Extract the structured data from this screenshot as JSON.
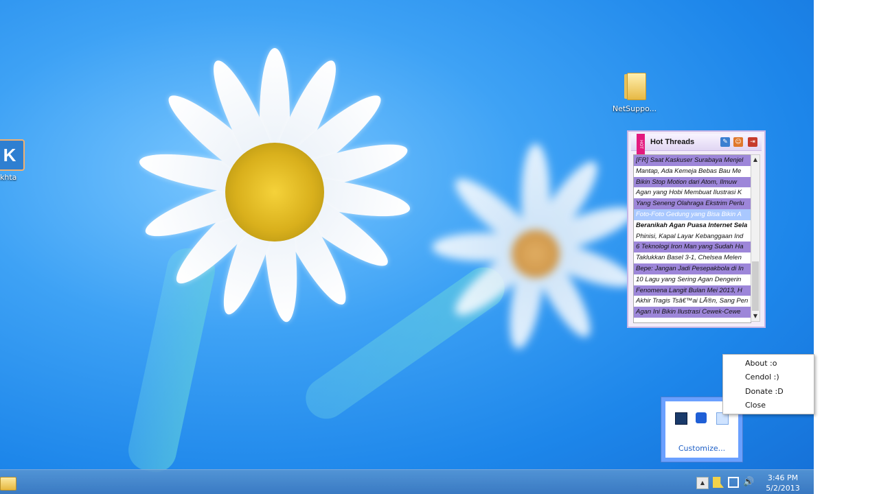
{
  "desktop": {
    "icons": [
      {
        "label": "NetSuppo..."
      },
      {
        "label": "khta"
      }
    ]
  },
  "widget": {
    "title": "Hot Threads",
    "ribbon": "HOT",
    "threads": [
      "[FR] Saat Kaskuser Surabaya Menjel",
      "Mantap, Ada Kemeja Bebas Bau Me",
      "Bikin Stop Motion dari Atom, Ilmuw",
      "Agan yang Hobi Membuat Ilustrasi K",
      "Yang Seneng Olahraga Ekstrim Perlu",
      "Foto-Foto Gedung yang Bisa Bikin A",
      "Beranikah Agan Puasa Internet Sela",
      "Phinisi, Kapal Layar Kebanggaan Ind",
      "6 Teknologi Iron Man yang Sudah Ha",
      "Taklukkan Basel 3-1, Chelsea Melen",
      "Bepe: Jangan Jadi Pesepakbola di In",
      "10 Lagu yang Sering Agan Dengerin",
      "Fenomena Langit Bulan Mei 2013, H",
      "Akhir Tragis Tsâ€™ai LÃ®n, Sang Pen",
      "Agan Ini Bikin Ilustrasi Cewek-Cewe"
    ]
  },
  "tray": {
    "customize": "Customize..."
  },
  "context_menu": {
    "items": [
      "About :o",
      "Cendol :)",
      "Donate :D",
      "Close"
    ]
  },
  "taskbar": {
    "time": "3:46 PM",
    "date": "5/2/2013"
  }
}
